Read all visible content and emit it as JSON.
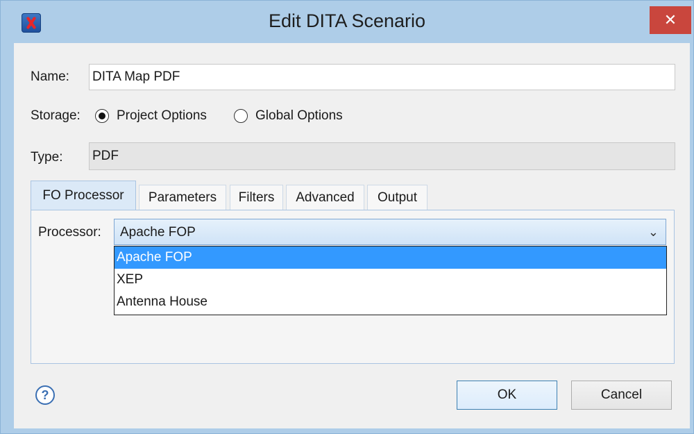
{
  "window": {
    "title": "Edit DITA Scenario",
    "close_symbol": "✕"
  },
  "form": {
    "name_label": "Name:",
    "name_value": "DITA Map PDF",
    "storage_label": "Storage:",
    "storage_options": [
      "Project Options",
      "Global Options"
    ],
    "storage_selected": "Project Options",
    "type_label": "Type:",
    "type_value": "PDF"
  },
  "tabs": [
    "FO Processor",
    "Parameters",
    "Filters",
    "Advanced",
    "Output"
  ],
  "active_tab": "FO Processor",
  "processor": {
    "label": "Processor:",
    "value": "Apache FOP",
    "options": [
      "Apache FOP",
      "XEP",
      "Antenna House"
    ],
    "highlighted": "Apache FOP"
  },
  "buttons": {
    "help": "?",
    "ok": "OK",
    "cancel": "Cancel"
  },
  "icons": {
    "app": "oxygen-app-icon",
    "close": "close-icon",
    "help": "help-icon",
    "chevron": "chevron-down-icon"
  },
  "colors": {
    "title_bar": "#aecde8",
    "close_button": "#c9463d",
    "selection": "#3399ff",
    "active_tab": "#dbe9f7"
  }
}
